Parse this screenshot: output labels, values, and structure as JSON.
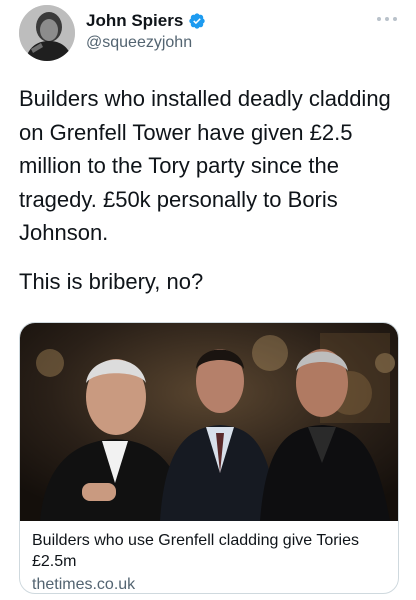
{
  "author": {
    "display_name": "John Spiers",
    "handle": "@squeezyjohn",
    "verified": true
  },
  "tweet": {
    "text": "Builders who installed deadly cladding on Grenfell Tower have given £2.5 million to the Tory party since the tragedy. £50k personally to Boris Johnson.",
    "text2": "This is bribery, no?"
  },
  "card": {
    "title": "Builders who use Grenfell cladding give Tories £2.5m",
    "domain": "thetimes.co.uk"
  },
  "icons": {
    "verified": "verified-badge-icon",
    "more": "more-options-icon"
  },
  "colors": {
    "verified": "#1d9bf0",
    "secondary_text": "#536471",
    "card_border": "#cfd9de"
  }
}
